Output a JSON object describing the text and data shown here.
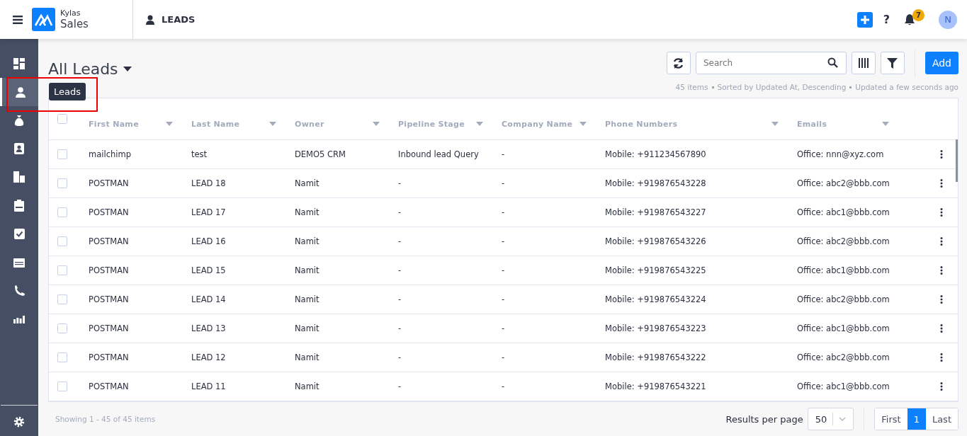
{
  "header": {
    "brand_top": "Kylas",
    "brand_bottom": "Sales",
    "module": "LEADS",
    "notification_count": "7",
    "avatar_initial": "N",
    "help": "?"
  },
  "sidebar": {
    "items": [
      {
        "kind": "dashboard",
        "selected": false
      },
      {
        "kind": "leads",
        "selected": true
      },
      {
        "kind": "deals",
        "selected": false
      },
      {
        "kind": "contacts",
        "selected": false
      },
      {
        "kind": "companies",
        "selected": false
      },
      {
        "kind": "quotes",
        "selected": false
      },
      {
        "kind": "tasks",
        "selected": false
      },
      {
        "kind": "calendar",
        "selected": false
      },
      {
        "kind": "calls",
        "selected": false
      },
      {
        "kind": "reports",
        "selected": false
      }
    ],
    "tooltip": "Leads"
  },
  "view": {
    "title": "All Leads",
    "search_placeholder": "Search",
    "add_button": "Add",
    "meta": [
      "45 items",
      "Sorted by Updated At, Descending",
      "Updated a few seconds ago"
    ]
  },
  "table": {
    "all_selected": false,
    "columns": [
      "First Name",
      "Last Name",
      "Owner",
      "Pipeline Stage",
      "Company Name",
      "Phone Numbers",
      "Emails"
    ],
    "rows": [
      {
        "selected": false,
        "cells": [
          "mailchimp",
          "test",
          "DEMO5 CRM",
          "Inbound lead Query",
          "-",
          "Mobile: +911234567890",
          "Office: nnn@xyz.com"
        ]
      },
      {
        "selected": false,
        "cells": [
          "POSTMAN",
          "LEAD 18",
          "Namit",
          "-",
          "-",
          "Mobile: +919876543228",
          "Office: abc2@bbb.com"
        ]
      },
      {
        "selected": false,
        "cells": [
          "POSTMAN",
          "LEAD 17",
          "Namit",
          "-",
          "-",
          "Mobile: +919876543227",
          "Office: abc1@bbb.com"
        ]
      },
      {
        "selected": false,
        "cells": [
          "POSTMAN",
          "LEAD 16",
          "Namit",
          "-",
          "-",
          "Mobile: +919876543226",
          "Office: abc2@bbb.com"
        ]
      },
      {
        "selected": false,
        "cells": [
          "POSTMAN",
          "LEAD 15",
          "Namit",
          "-",
          "-",
          "Mobile: +919876543225",
          "Office: abc1@bbb.com"
        ]
      },
      {
        "selected": false,
        "cells": [
          "POSTMAN",
          "LEAD 14",
          "Namit",
          "-",
          "-",
          "Mobile: +919876543224",
          "Office: abc2@bbb.com"
        ]
      },
      {
        "selected": false,
        "cells": [
          "POSTMAN",
          "LEAD 13",
          "Namit",
          "-",
          "-",
          "Mobile: +919876543223",
          "Office: abc1@bbb.com"
        ]
      },
      {
        "selected": false,
        "cells": [
          "POSTMAN",
          "LEAD 12",
          "Namit",
          "-",
          "-",
          "Mobile: +919876543222",
          "Office: abc2@bbb.com"
        ]
      },
      {
        "selected": false,
        "cells": [
          "POSTMAN",
          "LEAD 11",
          "Namit",
          "-",
          "-",
          "Mobile: +919876543221",
          "Office: abc1@bbb.com"
        ]
      }
    ]
  },
  "footer": {
    "showing": "Showing 1 - 45 of 45 items",
    "results_label": "Results per page",
    "per_page": "50",
    "first": "First",
    "last": "Last",
    "pages": [
      {
        "label": "1",
        "selected": true
      }
    ]
  }
}
